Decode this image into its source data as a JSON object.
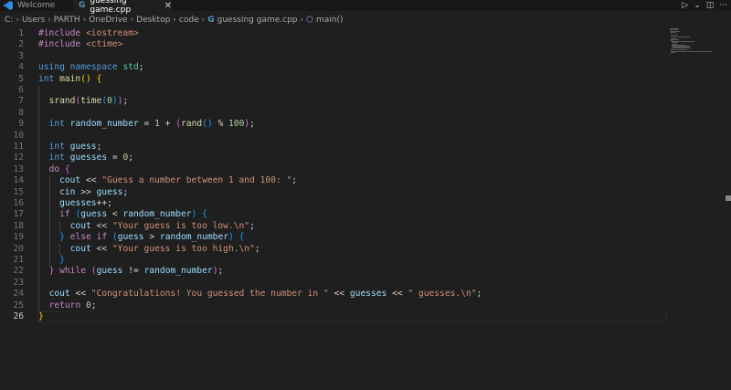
{
  "tabs": [
    {
      "label": "Welcome",
      "icon": "vscode-icon",
      "active": false
    },
    {
      "label": "guessing game.cpp",
      "icon": "cpp-file-icon",
      "active": true
    }
  ],
  "breadcrumb": [
    "C:",
    "Users",
    "PARTH",
    "OneDrive",
    "Desktop",
    "code",
    "guessing game.cpp",
    "main()"
  ],
  "code_lines": [
    "#include <iostream>",
    "#include <ctime>",
    "",
    "using namespace std;",
    "int main() {",
    "",
    "  srand(time(0));",
    "",
    "  int random_number = 1 + (rand() % 100);",
    "",
    "  int guess;",
    "  int guesses = 0;",
    "  do {",
    "    cout << \"Guess a number between 1 and 100: \";",
    "    cin >> guess;",
    "    guesses++;",
    "    if (guess < random_number) {",
    "      cout << \"Your guess is too low.\\n\";",
    "    } else if (guess > random_number) {",
    "      cout << \"Your guess is too high.\\n\";",
    "    }",
    "  } while (guess != random_number);",
    "",
    "  cout << \"Congratulations! You guessed the number in \" << guesses << \" guesses.\\n\";",
    "  return 0;",
    "}"
  ],
  "active_line": 26,
  "colors": {
    "background": "#1f1f1f",
    "tabbar": "#181818",
    "accent": "#519aba"
  }
}
